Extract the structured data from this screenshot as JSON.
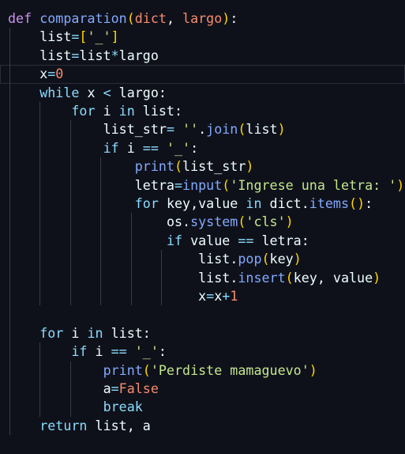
{
  "editor": {
    "theme_colors": {
      "background": "#0f111a",
      "keyword": "#89ddff",
      "def_keyword": "#c792ea",
      "function": "#82aaff",
      "parameter": "#f78c6c",
      "string": "#c3e88d",
      "number": "#f78c6c",
      "bracket": "#ffd700",
      "identifier": "#eeffff"
    },
    "lines": [
      "def comparation(dict, largo):",
      "    list=['_']",
      "    list=list*largo",
      "    x=0",
      "    while x < largo:",
      "        for i in list:",
      "            list_str= ''.join(list)",
      "            if i == '_':",
      "                print(list_str)",
      "                letra=input('Ingrese una letra: ')",
      "                for key,value in dict.items():",
      "                    os.system('cls')",
      "                    if value == letra:",
      "                        list.pop(key)",
      "                        list.insert(key, value)",
      "                        x=x+1",
      "",
      "    for i in list:",
      "        if i == '_':",
      "            print('Perdiste mamaguevo')",
      "            a=False",
      "            break",
      "    return list, a"
    ]
  }
}
